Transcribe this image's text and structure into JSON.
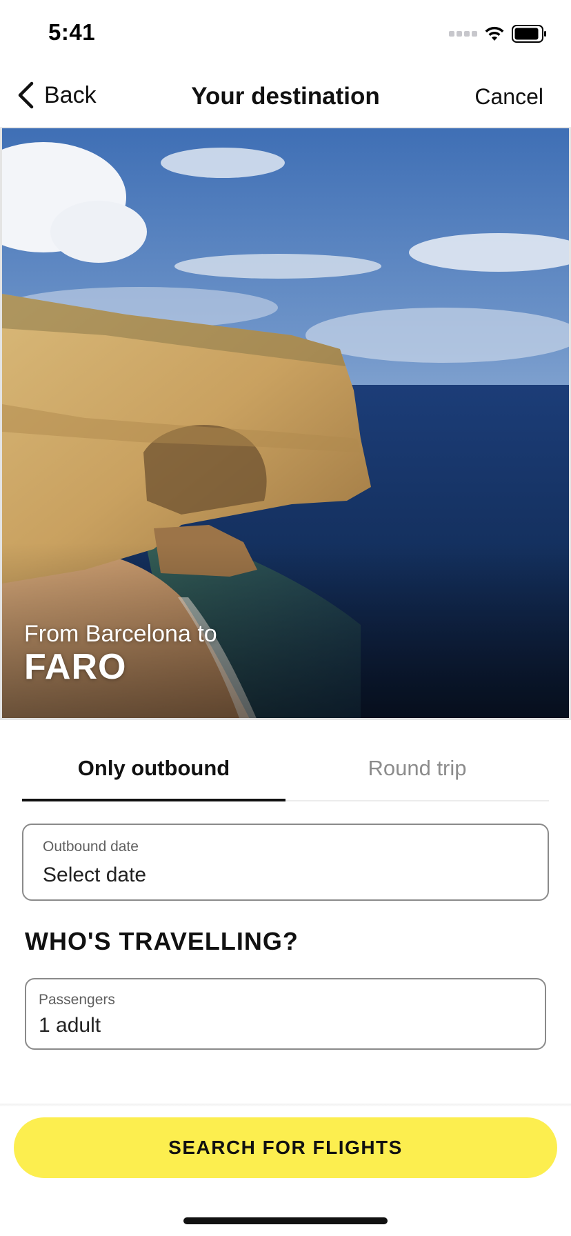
{
  "status_bar": {
    "time": "5:41",
    "icons": [
      "signal-dots-icon",
      "wifi-icon",
      "battery-icon"
    ]
  },
  "nav": {
    "back_label": "Back",
    "title": "Your destination",
    "cancel_label": "Cancel"
  },
  "hero": {
    "from_text": "From Barcelona to",
    "destination": "FARO"
  },
  "tabs": [
    {
      "label": "Only outbound",
      "active": true
    },
    {
      "label": "Round trip",
      "active": false
    }
  ],
  "outbound_field": {
    "label": "Outbound date",
    "value": "Select date"
  },
  "travellers": {
    "heading": "WHO'S TRAVELLING?",
    "label": "Passengers",
    "value": "1 adult"
  },
  "actions": {
    "search_label": "SEARCH FOR FLIGHTS"
  },
  "colors": {
    "accent_yellow": "#fcee4f",
    "text_primary": "#111111",
    "text_muted": "#8c8c8c",
    "field_border": "#8a8a8a"
  }
}
